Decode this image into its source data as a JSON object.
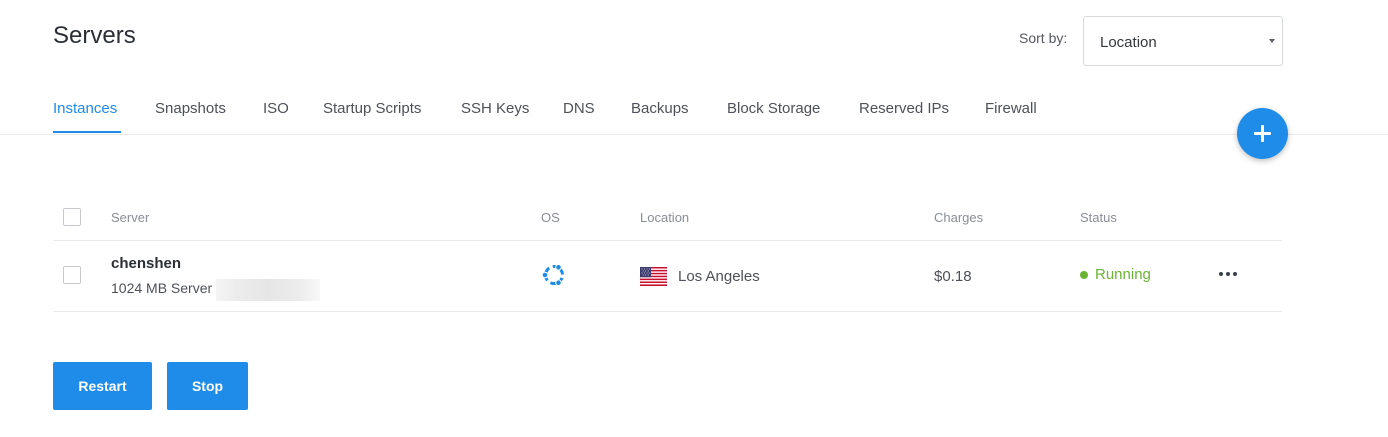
{
  "page": {
    "title": "Servers"
  },
  "sort": {
    "label": "Sort by:",
    "value": "Location"
  },
  "tabs": [
    {
      "label": "Instances",
      "active": true
    },
    {
      "label": "Snapshots"
    },
    {
      "label": "ISO"
    },
    {
      "label": "Startup Scripts"
    },
    {
      "label": "SSH Keys"
    },
    {
      "label": "DNS"
    },
    {
      "label": "Backups"
    },
    {
      "label": "Block Storage"
    },
    {
      "label": "Reserved IPs"
    },
    {
      "label": "Firewall"
    }
  ],
  "table": {
    "headers": {
      "server": "Server",
      "os": "OS",
      "location": "Location",
      "charges": "Charges",
      "status": "Status"
    },
    "rows": [
      {
        "name": "chenshen",
        "desc": "1024 MB Server",
        "os_icon": "ubuntu-icon",
        "flag_icon": "us-flag-icon",
        "location": "Los Angeles",
        "charges": "$0.18",
        "status": "Running"
      }
    ]
  },
  "actions": {
    "restart": "Restart",
    "stop": "Stop"
  },
  "colors": {
    "accent": "#1e8ce8",
    "running": "#6ab334"
  }
}
